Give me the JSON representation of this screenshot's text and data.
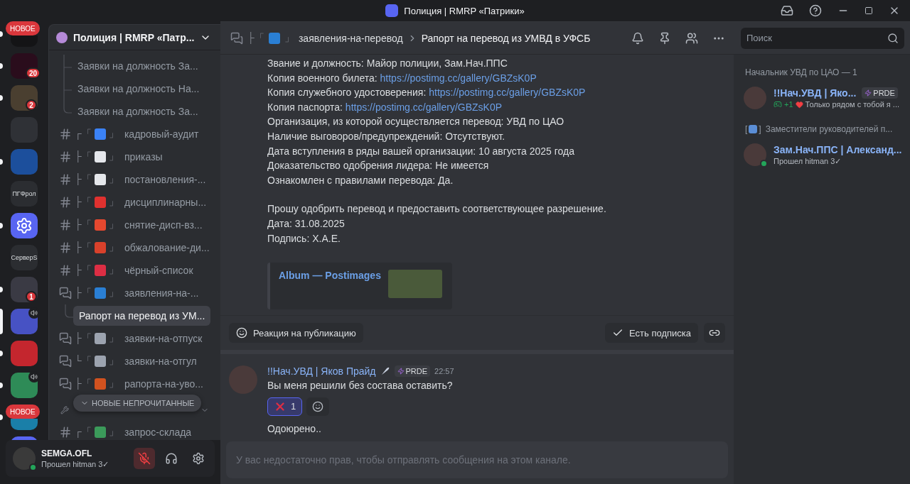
{
  "window": {
    "title": "Полиция | RMRP «Патрики»"
  },
  "servers": [
    {
      "kind": "image",
      "color": "#141416",
      "pill": "НОВОЕ",
      "unread": true,
      "selected": false
    },
    {
      "kind": "image",
      "color": "#2a0d1c",
      "badge": "20",
      "unread": true,
      "selected": false
    },
    {
      "kind": "image",
      "color": "#4a3f30",
      "badge": "2",
      "unread": true,
      "selected": false
    },
    {
      "kind": "image",
      "color": "#2f3136",
      "unread": false,
      "selected": false
    },
    {
      "kind": "image",
      "color": "#1c4f9c",
      "unread": true,
      "selected": false
    },
    {
      "kind": "text",
      "label": "ПГФрол",
      "unread": false,
      "selected": false
    },
    {
      "kind": "app",
      "color": "#5865f2",
      "unread": true,
      "selected": false
    },
    {
      "kind": "text",
      "label": "СерверS",
      "unread": false,
      "selected": false
    },
    {
      "kind": "image",
      "color": "#3a3a44",
      "badge": "1",
      "unread": true,
      "selected": false
    },
    {
      "kind": "image",
      "color": "#4752c4",
      "voice": true,
      "unread": false,
      "selected": true
    },
    {
      "kind": "image",
      "color": "#c4262e",
      "unread": true,
      "selected": false
    },
    {
      "kind": "image",
      "color": "#2e8b57",
      "voice": true,
      "unread": true,
      "selected": false
    },
    {
      "kind": "image",
      "color": "#1a7fa8",
      "pill": "НОВОЕ",
      "unread": true,
      "selected": false
    },
    {
      "kind": "image",
      "color": "#5865f2",
      "unread": false,
      "selected": false
    }
  ],
  "guild": {
    "name": "Полиция | RMRP «Патр..."
  },
  "top_threads": [
    "Заявки на должность За...",
    "Заявки на должность На...",
    "Заявки на должность За..."
  ],
  "channels": [
    {
      "kind": "text",
      "prefix": "┌「",
      "color": "#3b82f6",
      "suffix": "」",
      "name": "кадровый-аудит"
    },
    {
      "kind": "text",
      "prefix": "├「",
      "color": "#e5e7eb",
      "suffix": "」",
      "name": "приказы"
    },
    {
      "kind": "text",
      "prefix": "├「",
      "color": "#e5e7eb",
      "suffix": "」",
      "name": "постановления-..."
    },
    {
      "kind": "text",
      "prefix": "├「",
      "color": "#e0312f",
      "suffix": "」",
      "name": "дисциплинарны..."
    },
    {
      "kind": "text",
      "prefix": "├「",
      "color": "#e5482f",
      "suffix": "」",
      "name": "снятие-дисп-вз..."
    },
    {
      "kind": "text",
      "prefix": "├「",
      "color": "#d9412b",
      "suffix": "」",
      "name": "обжалование-ди..."
    },
    {
      "kind": "text",
      "prefix": "├「",
      "color": "#dd2e44",
      "suffix": "」",
      "name": "чёрный-список"
    },
    {
      "kind": "forum",
      "prefix": "├「",
      "color": "#2a7fd4",
      "suffix": "」",
      "name": "заявления-на-...",
      "threads": [
        {
          "label": "Рапорт на перевод из УМ...",
          "selected": true
        }
      ]
    },
    {
      "kind": "forum",
      "prefix": "├「",
      "color": "#9ca3af",
      "suffix": "」",
      "name": "заявки-на-отпуск"
    },
    {
      "kind": "forum",
      "prefix": "└「",
      "color": "#9ca3af",
      "suffix": "」",
      "name": "заявки-на-отгул"
    },
    {
      "kind": "forum",
      "prefix": "├「",
      "color": "#d2521f",
      "suffix": "」",
      "name": "рапорта-на-уво..."
    },
    {
      "kind": "category"
    },
    {
      "kind": "text",
      "prefix": "┌「",
      "color": "#3b9a5a",
      "suffix": "」",
      "name": "запрос-склада"
    }
  ],
  "unread_pill": "НОВЫЕ НЕПРОЧИТАННЫЕ",
  "user": {
    "name": "SEMGA.OFL",
    "status": "Прошел hitman 3✓",
    "muted": true
  },
  "header": {
    "prefix": "├「",
    "color": "#2a7fd4",
    "suffix": "」",
    "channel": "заявления-на-перевод",
    "thread": "Рапорт на перевод из УМВД в УФСБ",
    "search": {
      "placeholder": "Поиск"
    }
  },
  "post": {
    "paragraphs": [
      {
        "lines": [
          {
            "text": "Звание и должность: Майор полиции, Зам.Нач.ППС"
          },
          {
            "text": "Копия военного билета:",
            "link": "https://postimg.cc/gallery/GBZsK0P"
          },
          {
            "text": "Копия служебного удостоверения:",
            "link": "https://postimg.cc/gallery/GBZsK0P"
          },
          {
            "text": "Копия паспорта:",
            "link": "https://postimg.cc/gallery/GBZsK0P"
          },
          {
            "text": "Организация, из которой осуществляется перевод: УВД по ЦАО"
          },
          {
            "text": "Наличие выговоров/предупреждений: Отсутствуют."
          },
          {
            "text": "Дата вступления в ряды вашей организации: 10 августа 2025 года"
          },
          {
            "text": "Доказательство одобрения лидера: Не имеется"
          },
          {
            "text": "Ознакомлен с правилами перевода: Да."
          }
        ]
      },
      {
        "lines": [
          {
            "text": "Прошу одобрить перевод и предоставить соответствующее разрешение."
          },
          {
            "text": "Дата: 31.08.2025"
          },
          {
            "text": "Подпись: Х.А.Е."
          }
        ]
      }
    ],
    "embed": {
      "title": "Album — Postimages"
    },
    "react_button": "Реакция на публикацию",
    "follow_button": {
      "label": "Есть подписка",
      "following": true
    }
  },
  "messages": [
    {
      "author": "!!Нач.УВД | Яков Прайд",
      "tag": "PRDE",
      "time": "22:57",
      "lines": [
        "Вы меня решили без состава оставить?"
      ],
      "reactions": [
        {
          "count": "1",
          "selected": true
        }
      ],
      "after": "Одоюрено.."
    }
  ],
  "composer": {
    "placeholder": "У вас недостаточно прав, чтобы отправлять сообщения на этом канале."
  },
  "members": [
    {
      "group": "Начальник УВД по ЦАО — 1",
      "items": [
        {
          "name": "!!Нач.УВД | Яко...",
          "tag": "PRDE",
          "status_count": "+1",
          "status": "Только рядом с тобой я ...",
          "online": false
        }
      ]
    },
    {
      "group": "Заместители руководителей п...",
      "group_prefix": "[",
      "group_suffix": "]",
      "items": [
        {
          "name": "Зам.Нач.ППС | Александ...",
          "status": "Прошел hitman 3✓",
          "online": true
        }
      ]
    }
  ]
}
